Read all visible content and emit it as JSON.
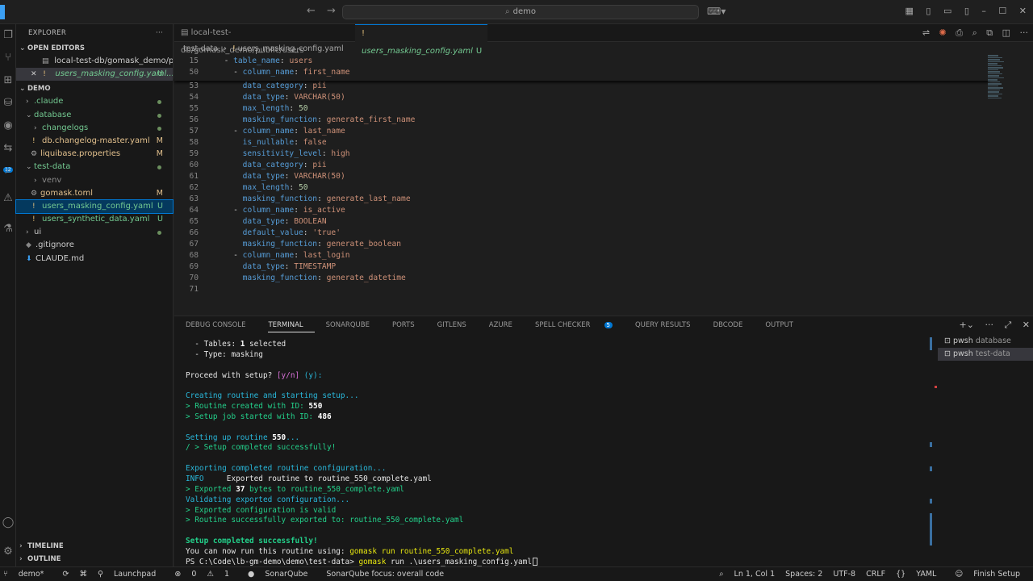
{
  "titlebar": {
    "search": "demo"
  },
  "sidebar": {
    "title": "EXPLORER",
    "open_editors_title": "OPEN EDITORS",
    "open_editors": [
      {
        "label": "local-test-db/gomask_demo/pu...",
        "status": ""
      },
      {
        "label": "users_masking_config.yaml...",
        "status": "U"
      }
    ],
    "workspace_title": "DEMO",
    "tree": [
      {
        "label": ".claude",
        "status": ""
      },
      {
        "label": "database",
        "status": ""
      },
      {
        "label": "changelogs",
        "status": ""
      },
      {
        "label": "db.changelog-master.yaml",
        "status": "M"
      },
      {
        "label": "liquibase.properties",
        "status": "M"
      },
      {
        "label": "test-data",
        "status": ""
      },
      {
        "label": "venv",
        "status": ""
      },
      {
        "label": "gomask.toml",
        "status": "M"
      },
      {
        "label": "users_masking_config.yaml",
        "status": "U"
      },
      {
        "label": "users_synthetic_data.yaml",
        "status": "U"
      },
      {
        "label": "ui",
        "status": ""
      },
      {
        "label": ".gitignore",
        "status": ""
      },
      {
        "label": "CLAUDE.md",
        "status": ""
      }
    ],
    "timeline": "TIMELINE",
    "outline": "OUTLINE"
  },
  "tabs": [
    {
      "label": "local-test-db/gomask_demo/public/users"
    },
    {
      "label": "users_masking_config.yaml",
      "status": "U"
    }
  ],
  "breadcrumb": {
    "folder": "test-data",
    "file": "users_masking_config.yaml"
  },
  "code": {
    "sticky": [
      {
        "num": "15",
        "indent": "  ",
        "dash": "- ",
        "key": "table_name",
        "val": "users",
        "vt": "v"
      },
      {
        "num": "50",
        "indent": "    ",
        "dash": "- ",
        "key": "column_name",
        "val": "first_name",
        "vt": "v"
      }
    ],
    "lines": [
      {
        "num": "53",
        "indent": "      ",
        "dash": "",
        "key": "data_category",
        "val": "pii",
        "vt": "v"
      },
      {
        "num": "54",
        "indent": "      ",
        "dash": "",
        "key": "data_type",
        "val": "VARCHAR(50)",
        "vt": "v"
      },
      {
        "num": "55",
        "indent": "      ",
        "dash": "",
        "key": "max_length",
        "val": "50",
        "vt": "n"
      },
      {
        "num": "56",
        "indent": "      ",
        "dash": "",
        "key": "masking_function",
        "val": "generate_first_name",
        "vt": "v"
      },
      {
        "num": "57",
        "indent": "    ",
        "dash": "- ",
        "key": "column_name",
        "val": "last_name",
        "vt": "v"
      },
      {
        "num": "58",
        "indent": "      ",
        "dash": "",
        "key": "is_nullable",
        "val": "false",
        "vt": "v"
      },
      {
        "num": "59",
        "indent": "      ",
        "dash": "",
        "key": "sensitivity_level",
        "val": "high",
        "vt": "v"
      },
      {
        "num": "60",
        "indent": "      ",
        "dash": "",
        "key": "data_category",
        "val": "pii",
        "vt": "v"
      },
      {
        "num": "61",
        "indent": "      ",
        "dash": "",
        "key": "data_type",
        "val": "VARCHAR(50)",
        "vt": "v"
      },
      {
        "num": "62",
        "indent": "      ",
        "dash": "",
        "key": "max_length",
        "val": "50",
        "vt": "n"
      },
      {
        "num": "63",
        "indent": "      ",
        "dash": "",
        "key": "masking_function",
        "val": "generate_last_name",
        "vt": "v"
      },
      {
        "num": "64",
        "indent": "    ",
        "dash": "- ",
        "key": "column_name",
        "val": "is_active",
        "vt": "v"
      },
      {
        "num": "65",
        "indent": "      ",
        "dash": "",
        "key": "data_type",
        "val": "BOOLEAN",
        "vt": "v"
      },
      {
        "num": "66",
        "indent": "      ",
        "dash": "",
        "key": "default_value",
        "val": "'true'",
        "vt": "v"
      },
      {
        "num": "67",
        "indent": "      ",
        "dash": "",
        "key": "masking_function",
        "val": "generate_boolean",
        "vt": "v"
      },
      {
        "num": "68",
        "indent": "    ",
        "dash": "- ",
        "key": "column_name",
        "val": "last_login",
        "vt": "v"
      },
      {
        "num": "69",
        "indent": "      ",
        "dash": "",
        "key": "data_type",
        "val": "TIMESTAMP",
        "vt": "v"
      },
      {
        "num": "70",
        "indent": "      ",
        "dash": "",
        "key": "masking_function",
        "val": "generate_datetime",
        "vt": "v"
      },
      {
        "num": "71",
        "indent": "",
        "dash": "",
        "key": "",
        "val": "",
        "vt": "v"
      }
    ]
  },
  "panel": {
    "tabs": [
      "DEBUG CONSOLE",
      "TERMINAL",
      "SONARQUBE",
      "PORTS",
      "GITLENS",
      "AZURE",
      "SPELL CHECKER",
      "QUERY RESULTS",
      "DBCODE",
      "OUTPUT"
    ],
    "active_tab": "TERMINAL",
    "spell_badge": "5",
    "terminals": [
      {
        "shell": "pwsh",
        "name": "database"
      },
      {
        "shell": "pwsh",
        "name": "test-data"
      }
    ],
    "terminal_lines": [
      [
        {
          "t": "  - Tables: ",
          "c": "wh"
        },
        {
          "t": "1",
          "c": "wb"
        },
        {
          "t": " selected",
          "c": "wh"
        }
      ],
      [
        {
          "t": "  - Type: masking",
          "c": "wh"
        }
      ],
      [
        {
          "t": "",
          "c": "wh"
        }
      ],
      [
        {
          "t": "Proceed with setup? ",
          "c": "wh"
        },
        {
          "t": "[y/n]",
          "c": "mg"
        },
        {
          "t": " (y):",
          "c": "cy"
        }
      ],
      [
        {
          "t": "",
          "c": "wh"
        }
      ],
      [
        {
          "t": "Creating routine and starting setup...",
          "c": "cy"
        }
      ],
      [
        {
          "t": "> Routine created with ID: ",
          "c": "gr"
        },
        {
          "t": "550",
          "c": "wb"
        }
      ],
      [
        {
          "t": "> Setup job started with ID: ",
          "c": "gr"
        },
        {
          "t": "486",
          "c": "wb"
        }
      ],
      [
        {
          "t": "",
          "c": "wh"
        }
      ],
      [
        {
          "t": "Setting up routine ",
          "c": "cy"
        },
        {
          "t": "550",
          "c": "wb"
        },
        {
          "t": "...",
          "c": "cy"
        }
      ],
      [
        {
          "t": "/ > Setup completed successfully!",
          "c": "gr"
        }
      ],
      [
        {
          "t": "",
          "c": "wh"
        }
      ],
      [
        {
          "t": "Exporting completed routine configuration...",
          "c": "cy"
        }
      ],
      [
        {
          "t": "INFO",
          "c": "cy"
        },
        {
          "t": "     Exported routine to routine_550_complete.yaml",
          "c": "wh"
        }
      ],
      [
        {
          "t": "> Exported ",
          "c": "gr"
        },
        {
          "t": "37",
          "c": "wb"
        },
        {
          "t": " bytes to routine_550_complete.yaml",
          "c": "gr"
        }
      ],
      [
        {
          "t": "Validating exported configuration...",
          "c": "cy"
        }
      ],
      [
        {
          "t": "> Exported configuration is valid",
          "c": "gr"
        }
      ],
      [
        {
          "t": "> Routine successfully exported to: routine_550_complete.yaml",
          "c": "gr"
        }
      ],
      [
        {
          "t": "",
          "c": "wh"
        }
      ],
      [
        {
          "t": "Setup completed successfully!",
          "c": "gb"
        }
      ],
      [
        {
          "t": "You can now run this routine using: ",
          "c": "wh"
        },
        {
          "t": "gomask run routine_550_complete.yaml",
          "c": "yl"
        }
      ],
      [
        {
          "t": "PS C:\\Code\\lb-gm-demo\\demo\\test-data> ",
          "c": "wh"
        },
        {
          "t": "gomask",
          "c": "yl"
        },
        {
          "t": " run .\\users_masking_config.yaml",
          "c": "wh"
        }
      ]
    ]
  },
  "status": {
    "branch": "demo*",
    "errors": "0",
    "warnings": "1",
    "launchpad": "Launchpad",
    "sonarqube": "SonarQube",
    "sonar_focus": "SonarQube focus: overall code",
    "position": "Ln 1, Col 1",
    "spaces": "Spaces: 2",
    "encoding": "UTF-8",
    "eol": "CRLF",
    "language": "YAML",
    "finish": "Finish Setup"
  }
}
